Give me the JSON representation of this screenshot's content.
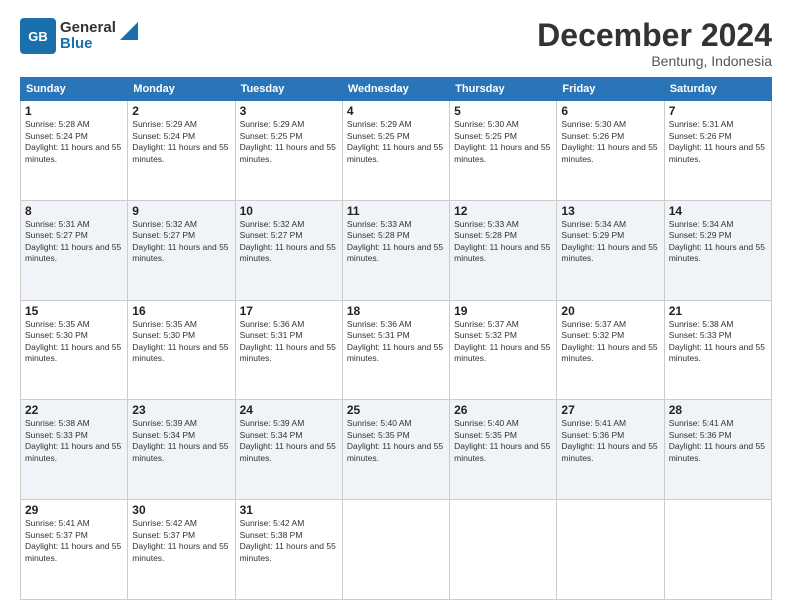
{
  "header": {
    "logo_line1": "General",
    "logo_line2": "Blue",
    "title": "December 2024",
    "subtitle": "Bentung, Indonesia"
  },
  "days_of_week": [
    "Sunday",
    "Monday",
    "Tuesday",
    "Wednesday",
    "Thursday",
    "Friday",
    "Saturday"
  ],
  "weeks": [
    [
      {
        "day": 1,
        "rise": "5:28 AM",
        "set": "5:24 PM",
        "daylight": "11 hours and 55 minutes."
      },
      {
        "day": 2,
        "rise": "5:29 AM",
        "set": "5:24 PM",
        "daylight": "11 hours and 55 minutes."
      },
      {
        "day": 3,
        "rise": "5:29 AM",
        "set": "5:25 PM",
        "daylight": "11 hours and 55 minutes."
      },
      {
        "day": 4,
        "rise": "5:29 AM",
        "set": "5:25 PM",
        "daylight": "11 hours and 55 minutes."
      },
      {
        "day": 5,
        "rise": "5:30 AM",
        "set": "5:25 PM",
        "daylight": "11 hours and 55 minutes."
      },
      {
        "day": 6,
        "rise": "5:30 AM",
        "set": "5:26 PM",
        "daylight": "11 hours and 55 minutes."
      },
      {
        "day": 7,
        "rise": "5:31 AM",
        "set": "5:26 PM",
        "daylight": "11 hours and 55 minutes."
      }
    ],
    [
      {
        "day": 8,
        "rise": "5:31 AM",
        "set": "5:27 PM",
        "daylight": "11 hours and 55 minutes."
      },
      {
        "day": 9,
        "rise": "5:32 AM",
        "set": "5:27 PM",
        "daylight": "11 hours and 55 minutes."
      },
      {
        "day": 10,
        "rise": "5:32 AM",
        "set": "5:27 PM",
        "daylight": "11 hours and 55 minutes."
      },
      {
        "day": 11,
        "rise": "5:33 AM",
        "set": "5:28 PM",
        "daylight": "11 hours and 55 minutes."
      },
      {
        "day": 12,
        "rise": "5:33 AM",
        "set": "5:28 PM",
        "daylight": "11 hours and 55 minutes."
      },
      {
        "day": 13,
        "rise": "5:34 AM",
        "set": "5:29 PM",
        "daylight": "11 hours and 55 minutes."
      },
      {
        "day": 14,
        "rise": "5:34 AM",
        "set": "5:29 PM",
        "daylight": "11 hours and 55 minutes."
      }
    ],
    [
      {
        "day": 15,
        "rise": "5:35 AM",
        "set": "5:30 PM",
        "daylight": "11 hours and 55 minutes."
      },
      {
        "day": 16,
        "rise": "5:35 AM",
        "set": "5:30 PM",
        "daylight": "11 hours and 55 minutes."
      },
      {
        "day": 17,
        "rise": "5:36 AM",
        "set": "5:31 PM",
        "daylight": "11 hours and 55 minutes."
      },
      {
        "day": 18,
        "rise": "5:36 AM",
        "set": "5:31 PM",
        "daylight": "11 hours and 55 minutes."
      },
      {
        "day": 19,
        "rise": "5:37 AM",
        "set": "5:32 PM",
        "daylight": "11 hours and 55 minutes."
      },
      {
        "day": 20,
        "rise": "5:37 AM",
        "set": "5:32 PM",
        "daylight": "11 hours and 55 minutes."
      },
      {
        "day": 21,
        "rise": "5:38 AM",
        "set": "5:33 PM",
        "daylight": "11 hours and 55 minutes."
      }
    ],
    [
      {
        "day": 22,
        "rise": "5:38 AM",
        "set": "5:33 PM",
        "daylight": "11 hours and 55 minutes."
      },
      {
        "day": 23,
        "rise": "5:39 AM",
        "set": "5:34 PM",
        "daylight": "11 hours and 55 minutes."
      },
      {
        "day": 24,
        "rise": "5:39 AM",
        "set": "5:34 PM",
        "daylight": "11 hours and 55 minutes."
      },
      {
        "day": 25,
        "rise": "5:40 AM",
        "set": "5:35 PM",
        "daylight": "11 hours and 55 minutes."
      },
      {
        "day": 26,
        "rise": "5:40 AM",
        "set": "5:35 PM",
        "daylight": "11 hours and 55 minutes."
      },
      {
        "day": 27,
        "rise": "5:41 AM",
        "set": "5:36 PM",
        "daylight": "11 hours and 55 minutes."
      },
      {
        "day": 28,
        "rise": "5:41 AM",
        "set": "5:36 PM",
        "daylight": "11 hours and 55 minutes."
      }
    ],
    [
      {
        "day": 29,
        "rise": "5:41 AM",
        "set": "5:37 PM",
        "daylight": "11 hours and 55 minutes."
      },
      {
        "day": 30,
        "rise": "5:42 AM",
        "set": "5:37 PM",
        "daylight": "11 hours and 55 minutes."
      },
      {
        "day": 31,
        "rise": "5:42 AM",
        "set": "5:38 PM",
        "daylight": "11 hours and 55 minutes."
      },
      null,
      null,
      null,
      null
    ]
  ]
}
